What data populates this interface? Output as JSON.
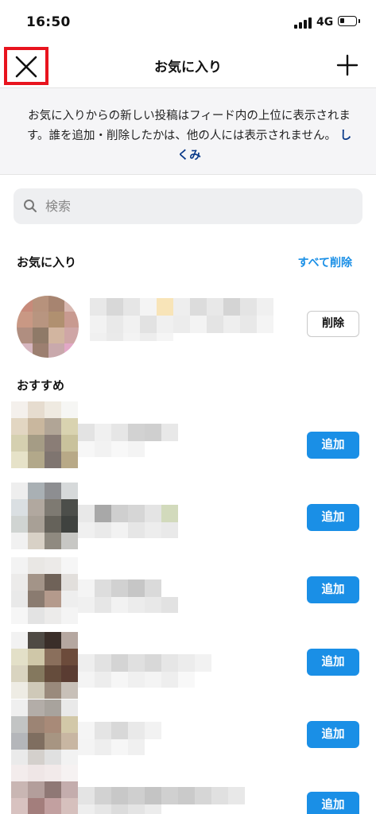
{
  "status_bar": {
    "time": "16:50",
    "network": "4G"
  },
  "nav": {
    "title": "お気に入り"
  },
  "info": {
    "text": "お気に入りからの新しい投稿はフィード内の上位に表示されます。誰を追加・削除したかは、他の人には表示されません。",
    "link": "しくみ"
  },
  "search": {
    "placeholder": "検索"
  },
  "favorites": {
    "title": "お気に入り",
    "remove_all": "すべて削除",
    "items": [
      {
        "action": "削除"
      }
    ]
  },
  "recommended": {
    "title": "おすすめ",
    "items": [
      {
        "action": "追加"
      },
      {
        "action": "追加"
      },
      {
        "action": "追加"
      },
      {
        "action": "追加"
      },
      {
        "action": "追加"
      },
      {
        "action": "追加"
      }
    ]
  },
  "colors": {
    "accent": "#1a8fe6",
    "highlight_box": "#e8141e",
    "link": "#0a3a8a"
  },
  "icons": [
    "close-icon",
    "plus-icon",
    "search-icon"
  ]
}
